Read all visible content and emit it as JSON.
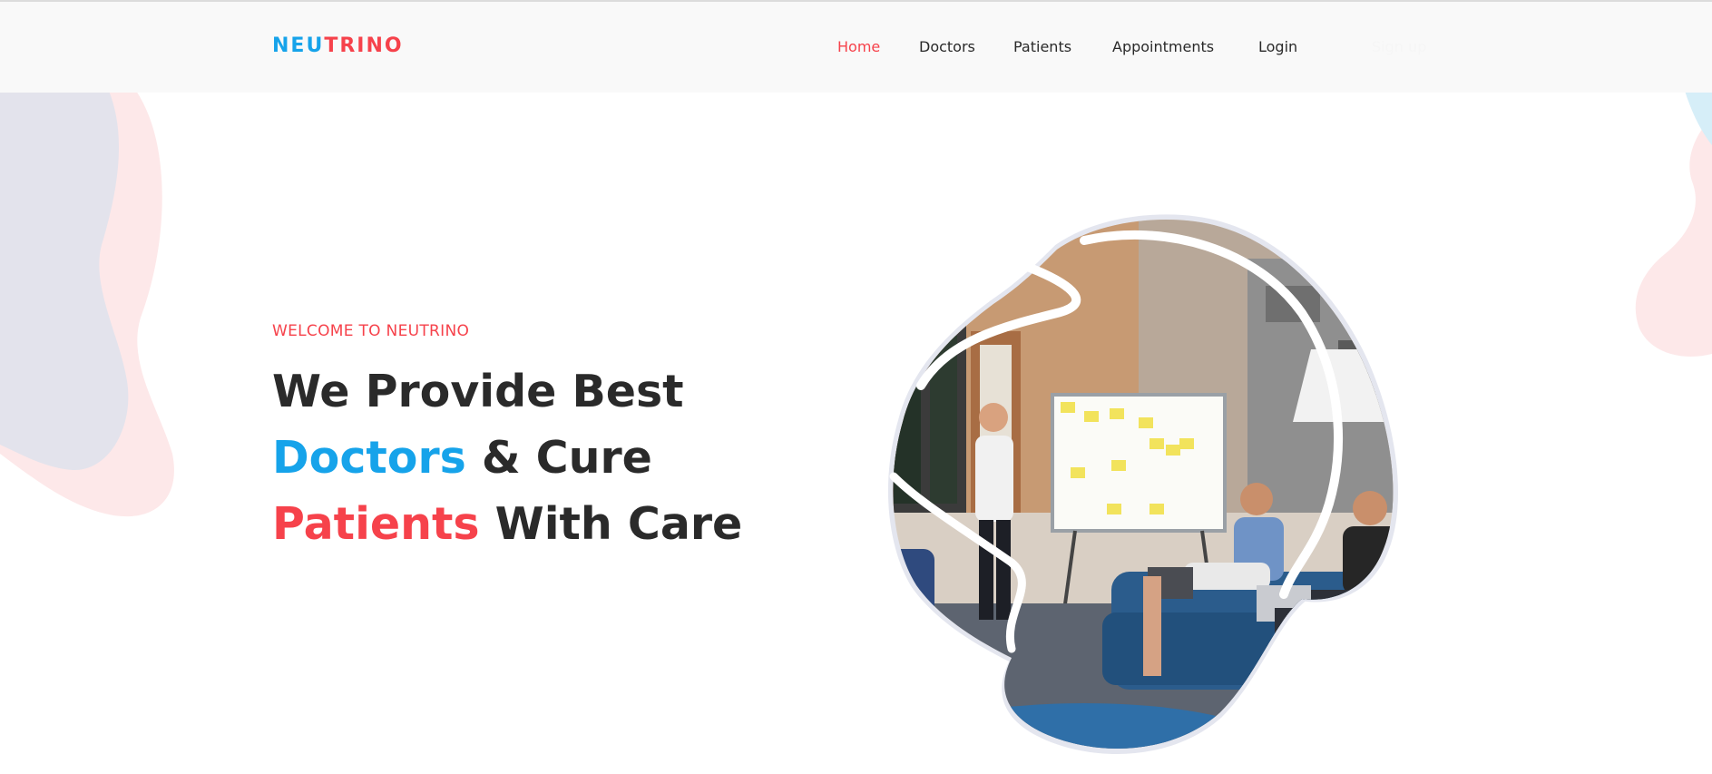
{
  "brand": {
    "part1": "NEU",
    "part2": "TRINO"
  },
  "nav": {
    "items": [
      {
        "label": "Home",
        "active": true
      },
      {
        "label": "Doctors",
        "active": false
      },
      {
        "label": "Patients",
        "active": false
      },
      {
        "label": "Appointments",
        "active": false
      },
      {
        "label": "Login",
        "active": false
      },
      {
        "label": "Sign up",
        "active": false
      }
    ]
  },
  "hero": {
    "welcome": "WELCOME TO NEUTRINO",
    "line1": "We Provide Best",
    "line2_highlight": "Doctors",
    "line2_rest": " & Cure",
    "line3_highlight": "Patients",
    "line3_rest": " With Care"
  },
  "colors": {
    "accent_blue": "#16a3ea",
    "accent_red": "#f6424b",
    "text_dark": "#2a2a2a",
    "nav_background": "#f9f9f9"
  }
}
